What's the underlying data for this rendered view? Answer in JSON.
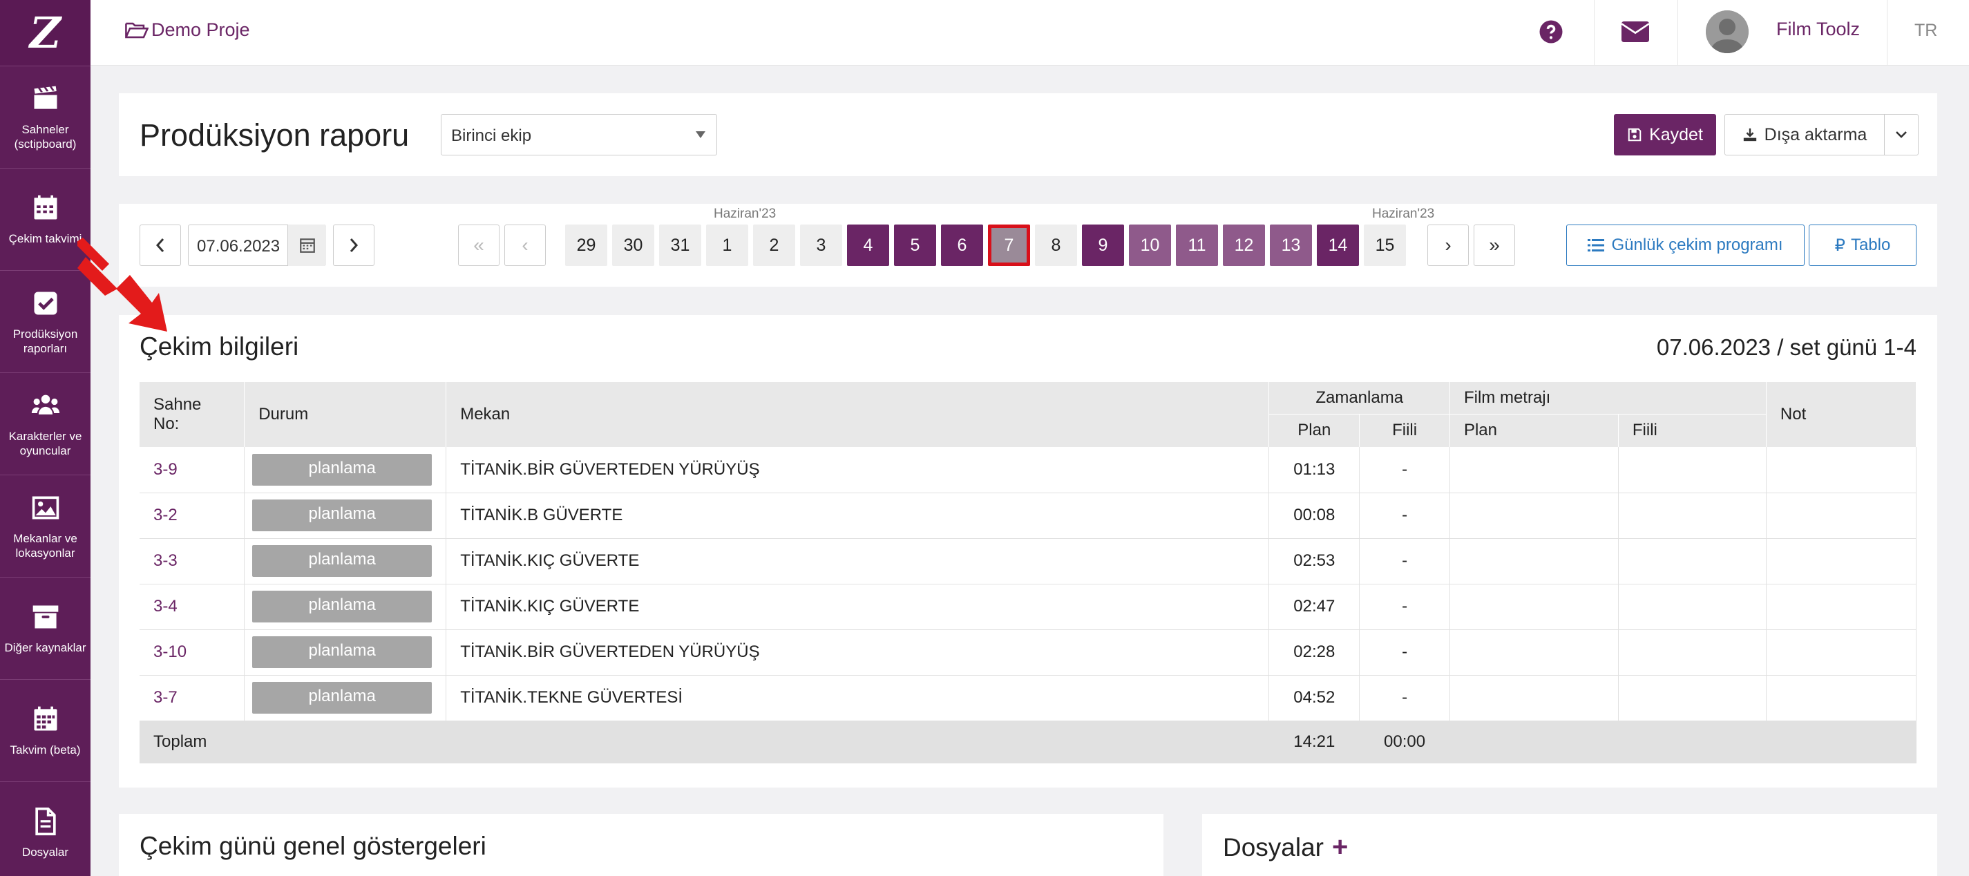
{
  "sidebar": {
    "logo": "Z",
    "items": [
      {
        "label": "Sahneler (sctipboard)",
        "icon": "clapperboard-icon"
      },
      {
        "label": "Çekim takvimi",
        "icon": "calendar-icon"
      },
      {
        "label": "Prodüksiyon raporları",
        "icon": "checkbox-icon"
      },
      {
        "label": "Karakterler ve oyuncular",
        "icon": "users-icon"
      },
      {
        "label": "Mekanlar ve lokasyonlar",
        "icon": "image-icon"
      },
      {
        "label": "Diğer kaynaklar",
        "icon": "archive-icon"
      },
      {
        "label": "Takvim (beta)",
        "icon": "calendar-grid-icon"
      },
      {
        "label": "Dosyalar",
        "icon": "file-icon"
      }
    ]
  },
  "topbar": {
    "project": "Demo Proje",
    "user": "Film Toolz",
    "lang": "TR"
  },
  "header": {
    "title": "Prodüksiyon raporu",
    "crew_select": "Birinci ekip",
    "save": "Kaydet",
    "export": "Dışa aktarma"
  },
  "datebar": {
    "date": "07.06.2023",
    "month_label_1": "Haziran'23",
    "month_label_2": "Haziran'23",
    "days": [
      "29",
      "30",
      "31",
      "1",
      "2",
      "3",
      "4",
      "5",
      "6",
      "7",
      "8",
      "9",
      "10",
      "11",
      "12",
      "13",
      "14",
      "15"
    ],
    "daily_schedule": "Günlük çekim programı",
    "table_btn": "Tablo"
  },
  "shooting": {
    "title": "Çekim bilgileri",
    "summary": "07.06.2023 / set günü 1-4",
    "headers": {
      "scene_no": "Sahne No:",
      "status": "Durum",
      "location": "Mekan",
      "timing": "Zamanlama",
      "footage": "Film metrajı",
      "note": "Not",
      "plan": "Plan",
      "actual": "Fiili"
    },
    "rows": [
      {
        "no": "3-9",
        "status": "planlama",
        "location": "TİTANİK.BİR GÜVERTEDEN YÜRÜYÜŞ",
        "plan": "01:13",
        "actual": "-"
      },
      {
        "no": "3-2",
        "status": "planlama",
        "location": "TİTANİK.B GÜVERTE",
        "plan": "00:08",
        "actual": "-"
      },
      {
        "no": "3-3",
        "status": "planlama",
        "location": "TİTANİK.KIÇ GÜVERTE",
        "plan": "02:53",
        "actual": "-"
      },
      {
        "no": "3-4",
        "status": "planlama",
        "location": "TİTANİK.KIÇ GÜVERTE",
        "plan": "02:47",
        "actual": "-"
      },
      {
        "no": "3-10",
        "status": "planlama",
        "location": "TİTANİK.BİR GÜVERTEDEN YÜRÜYÜŞ",
        "plan": "02:28",
        "actual": "-"
      },
      {
        "no": "3-7",
        "status": "planlama",
        "location": "TİTANİK.TEKNE GÜVERTESİ",
        "plan": "04:52",
        "actual": "-"
      }
    ],
    "total": {
      "label": "Toplam",
      "plan": "14:21",
      "actual": "00:00"
    }
  },
  "indicators_title": "Çekim günü genel göstergeleri",
  "files_title": "Dosyalar",
  "files_add": "+"
}
